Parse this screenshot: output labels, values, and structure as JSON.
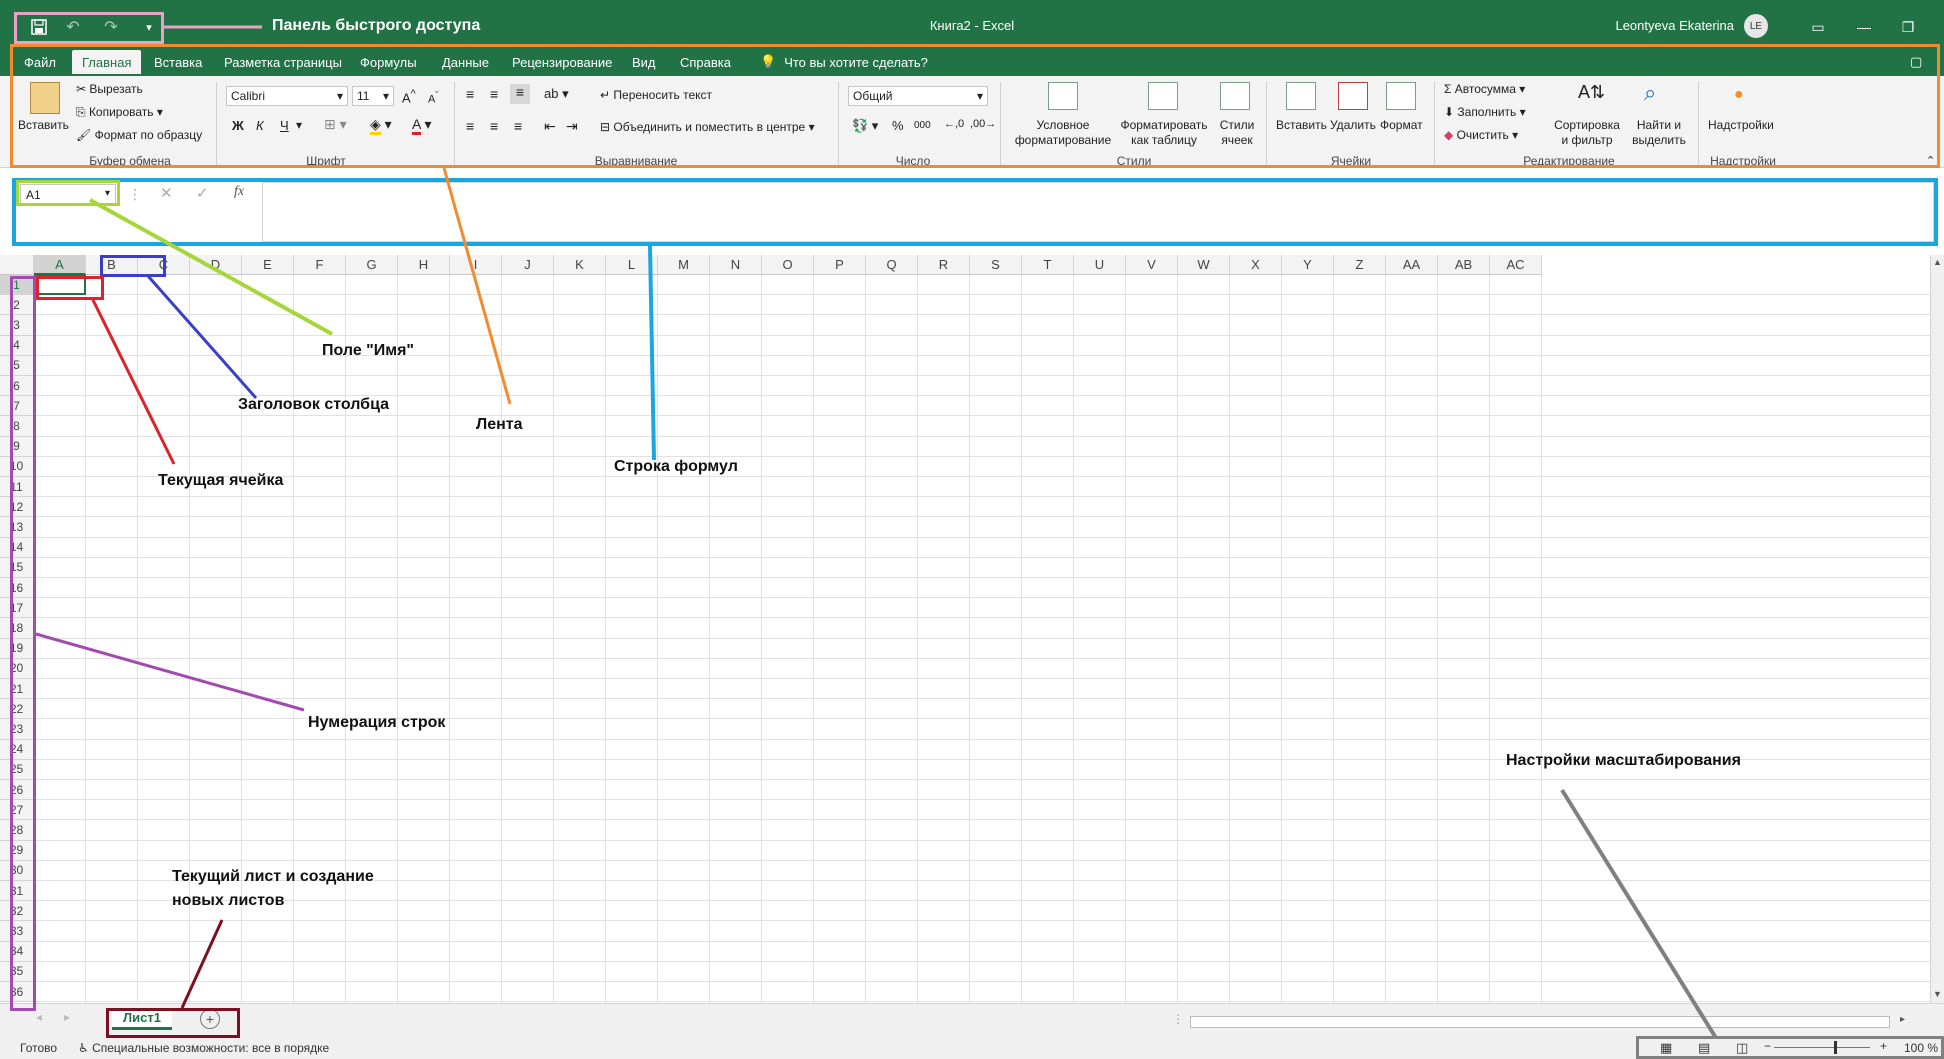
{
  "window": {
    "title": "Книга2  -  Excel",
    "user": "Leontyeva Ekaterina",
    "user_initials": "LE"
  },
  "tabs": [
    "Файл",
    "Главная",
    "Вставка",
    "Разметка страницы",
    "Формулы",
    "Данные",
    "Рецензирование",
    "Вид",
    "Справка"
  ],
  "active_tab": "Главная",
  "tell_me": "Что вы хотите сделать?",
  "ribbon": {
    "clipboard": {
      "paste": "Вставить",
      "cut": "Вырезать",
      "copy": "Копировать",
      "format_painter": "Формат по образцу",
      "label": "Буфер обмена"
    },
    "font": {
      "name": "Calibri",
      "size": "11",
      "bold": "Ж",
      "italic": "К",
      "underline": "Ч",
      "label": "Шрифт"
    },
    "alignment": {
      "wrap_text": "Переносить текст",
      "merge_center": "Объединить и поместить в центре",
      "label": "Выравнивание"
    },
    "number": {
      "format": "Общий",
      "label": "Число"
    },
    "styles": {
      "conditional_formatting": "Условное форматирование",
      "format_as_table": "Форматировать как таблицу",
      "cell_styles": "Стили ячеек",
      "label": "Стили"
    },
    "cells": {
      "insert": "Вставить",
      "delete": "Удалить",
      "format": "Формат",
      "label": "Ячейки"
    },
    "editing": {
      "autosum": "Автосумма",
      "fill": "Заполнить",
      "clear": "Очистить",
      "sort_filter": "Сортировка и фильтр",
      "find_select": "Найти и выделить",
      "label": "Редактирование"
    },
    "addins": {
      "addins": "Надстройки",
      "label": "Надстройки"
    }
  },
  "formula_bar": {
    "name_box": "A1",
    "fx": "fx"
  },
  "grid": {
    "columns": [
      "A",
      "B",
      "C",
      "D",
      "E",
      "F",
      "G",
      "H",
      "I",
      "J",
      "K",
      "L",
      "M",
      "N",
      "O",
      "P",
      "Q",
      "R",
      "S",
      "T",
      "U",
      "V",
      "W",
      "X",
      "Y",
      "Z",
      "AA",
      "AB",
      "AC"
    ],
    "rows": [
      "1",
      "2",
      "3",
      "4",
      "5",
      "6",
      "7",
      "8",
      "9",
      "10",
      "11",
      "12",
      "13",
      "14",
      "15",
      "16",
      "17",
      "18",
      "19",
      "20",
      "21",
      "22",
      "23",
      "24",
      "25",
      "26",
      "27",
      "28",
      "29",
      "30",
      "31",
      "32",
      "33",
      "34",
      "35",
      "36"
    ],
    "active_cell": "A1"
  },
  "sheets": {
    "active": "Лист1",
    "add_symbol": "+"
  },
  "status": {
    "ready": "Готово",
    "accessibility": "Специальные возможности: все в порядке",
    "zoom_minus": "−",
    "zoom_plus": "+",
    "zoom_level": "100 %"
  },
  "annotations": {
    "quick_access": "Панель быстрого доступа",
    "name_box": "Поле \"Имя\"",
    "column_header": "Заголовок столбца",
    "ribbon": "Лента",
    "formula_bar": "Строка формул",
    "current_cell": "Текущая ячейка",
    "row_numbers": "Нумерация строк",
    "zoom_settings": "Настройки масштабирования",
    "sheet_tabs_line1": "Текущий лист и создание",
    "sheet_tabs_line2": "новых листов"
  },
  "colors": {
    "excel_green": "#217346",
    "quick_access_box": "#e8a2c8",
    "ribbon_box": "#f28a30",
    "formula_box": "#1aa6e0",
    "name_box": "#a6d63a",
    "column_box": "#3a3fc8",
    "cell_box": "#e0202a",
    "row_box": "#a24ab0",
    "sheet_box": "#7a1020",
    "zoom_box": "#808080"
  }
}
